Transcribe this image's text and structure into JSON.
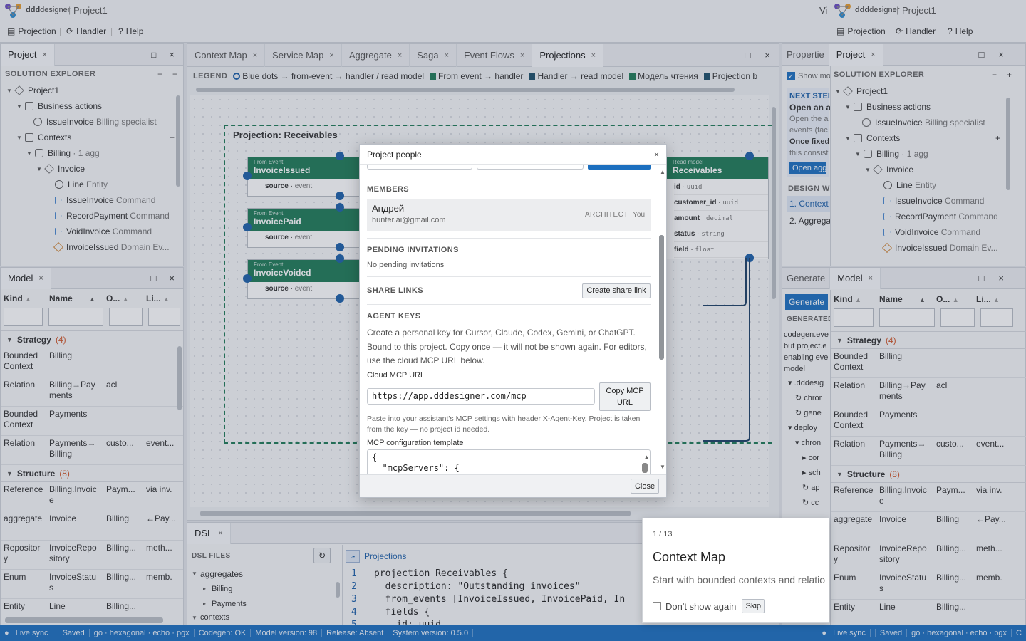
{
  "app": {
    "name_prefix": "ddd",
    "name_suffix": "designer",
    "project": "Project1",
    "right_prefix": "Vi"
  },
  "menu": [
    {
      "icon": "projection-icon",
      "label": "Projection"
    },
    {
      "icon": "handler-icon",
      "label": "Handler"
    },
    {
      "icon": "help-icon",
      "label": "Help"
    }
  ],
  "left_top": {
    "tab": "Project",
    "section": "SOLUTION EXPLORER",
    "tree": [
      {
        "label": "Project1",
        "extra": ""
      },
      {
        "label": "Business actions",
        "extra": ""
      },
      {
        "label": "IssueInvoice",
        "extra": "Billing specialist"
      },
      {
        "label": "Contexts",
        "extra": ""
      },
      {
        "label": "Billing",
        "extra": "· 1 agg"
      },
      {
        "label": "Invoice",
        "extra": ""
      },
      {
        "label": "Line",
        "extra": "Entity"
      },
      {
        "label": "IssueInvoice",
        "extra": "Command"
      },
      {
        "label": "RecordPayment",
        "extra": "Command"
      },
      {
        "label": "VoidInvoice",
        "extra": "Command"
      },
      {
        "label": "InvoiceIssued",
        "extra": "Domain Ev..."
      }
    ]
  },
  "model": {
    "tab": "Model",
    "cols": [
      "Kind",
      "Name",
      "O...",
      "Li..."
    ],
    "groups": [
      {
        "name": "Strategy",
        "count": "(4)",
        "rows": [
          [
            "Bounded Context",
            "Billing",
            "",
            ""
          ],
          [
            "Relation",
            "Billing→Payments",
            "acl",
            ""
          ],
          [
            "Bounded Context",
            "Payments",
            "",
            ""
          ],
          [
            "Relation",
            "Payments→Billing",
            "custo...",
            "event..."
          ]
        ]
      },
      {
        "name": "Structure",
        "count": "(8)",
        "rows": [
          [
            "Reference",
            "Billing.Invoice",
            "Paym...",
            "via inv."
          ],
          [
            "aggregate",
            "Invoice",
            "Billing",
            "←Pay..."
          ],
          [
            "Repository",
            "InvoiceRepository",
            "Billing...",
            "meth..."
          ],
          [
            "Enum",
            "InvoiceStatus",
            "Billing...",
            "memb."
          ],
          [
            "Entity",
            "Line",
            "Billing...",
            ""
          ]
        ]
      }
    ]
  },
  "center_tabs": [
    "Context Map",
    "Service Map",
    "Aggregate",
    "Saga",
    "Event Flows",
    "Projections"
  ],
  "legend": {
    "label": "LEGEND",
    "items": [
      "Blue dots → from-event → handler / read model",
      "From event → handler",
      "Handler → read model",
      "Модель чтения",
      "Projection b"
    ]
  },
  "canvas": {
    "projection_title": "Projection: Receivables",
    "events": [
      {
        "kind": "From Event",
        "name": "InvoiceIssued",
        "field": "source",
        "type": "event"
      },
      {
        "kind": "From Event",
        "name": "InvoicePaid",
        "field": "source",
        "type": "event"
      },
      {
        "kind": "From Event",
        "name": "InvoiceVoided",
        "field": "source",
        "type": "event"
      }
    ],
    "read_model": {
      "kind": "Read model",
      "name": "Receivables",
      "fields": [
        [
          "id",
          "uuid"
        ],
        [
          "customer_id",
          "uuid"
        ],
        [
          "amount",
          "decimal"
        ],
        [
          "status",
          "string"
        ],
        [
          "field",
          "float"
        ]
      ]
    }
  },
  "dsl": {
    "tab": "DSL",
    "files_label": "DSL FILES",
    "tree": [
      "aggregates",
      "Billing",
      "Payments",
      "contexts"
    ],
    "editor_tab": "Projections",
    "lines": [
      "projection Receivables {",
      "  description: \"Outstanding invoices\"",
      "  from_events [InvoiceIssued, InvoicePaid, In",
      "  fields {",
      "    id: uuid"
    ]
  },
  "right_panel": {
    "tabs": [
      "Propertie",
      "Project"
    ],
    "show_label": "Show mo",
    "next_steps": {
      "title": "NEXT STEI",
      "line1": "Open an a",
      "line2": "Open the a",
      "line3": "events (fac",
      "line4": "Once fixed",
      "line5": "this consist",
      "button": "Open agg"
    },
    "design_label": "DESIGN WO",
    "design_items": [
      "1. Context",
      "2. Aggrega"
    ],
    "gen_tabs": [
      "Generate",
      "Model"
    ],
    "gen_button": "Generate",
    "generated_label": "GENERATED",
    "gen_text": [
      "codegen.eve",
      "but project.e",
      "enabling eve",
      "model"
    ],
    "gen_tree": [
      ".dddesig",
      "chror",
      "gene",
      "deploy",
      "chron",
      "cor",
      "sch",
      "ap",
      "cc"
    ]
  },
  "modal": {
    "title": "Project people",
    "members_label": "MEMBERS",
    "member": {
      "name": "Андрей",
      "email": "hunter.ai@gmail.com",
      "role": "ARCHITECT",
      "you": "You"
    },
    "pending_label": "PENDING INVITATIONS",
    "pending_text": "No pending invitations",
    "share_label": "SHARE LINKS",
    "share_button": "Create share link",
    "agent_label": "AGENT KEYS",
    "agent_text": "Create a personal key for Cursor, Claude, Codex, Gemini, or ChatGPT. Bound to this project. Copy once — it will not be shown again. For editors, use the cloud MCP URL below.",
    "mcp_label": "Cloud MCP URL",
    "mcp_url": "https://app.dddesigner.com/mcp",
    "copy_button": "Copy MCP URL",
    "mcp_hint": "Paste into your assistant's MCP settings with header X-Agent-Key. Project is taken from the key — no project id needed.",
    "template_label": "MCP configuration template",
    "template_lines": [
      "{",
      "  \"mcpServers\": {"
    ],
    "close_button": "Close"
  },
  "tour": {
    "step": "1 / 13",
    "title": "Context Map",
    "text": "Start with bounded contexts and relatio",
    "checkbox": "Don't show again",
    "skip": "Skip"
  },
  "status": [
    "Live sync",
    "Saved",
    "go · hexagonal · echo · pgx",
    "Codegen: OK",
    "Model version: 98",
    "Release: Absent",
    "System version: 0.5.0"
  ],
  "status_right": [
    "Live sync",
    "Saved",
    "go · hexagonal · echo · pgx"
  ],
  "colors": {
    "accent": "#1c6fbf",
    "node": "#1e7a57",
    "dot": "#1c5fa8",
    "warning": "#d0572a"
  }
}
